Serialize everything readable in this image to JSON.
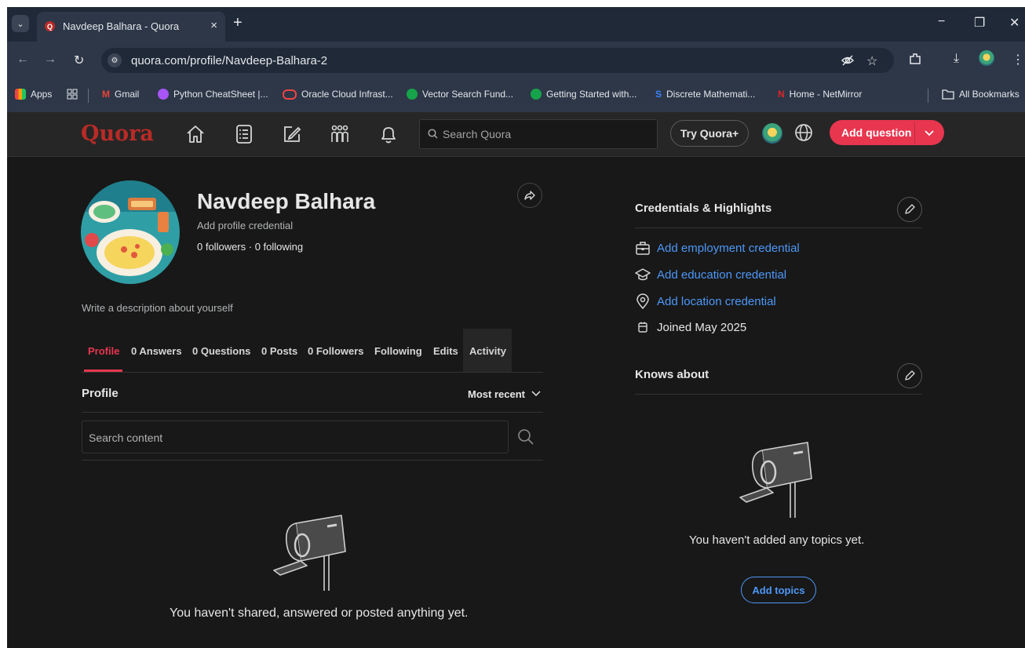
{
  "browser": {
    "tab_title": "Navdeep Balhara - Quora",
    "tab_close": "×",
    "new_tab": "+",
    "url": "quora.com/profile/Navdeep-Balhara-2",
    "bookmarks": [
      {
        "label": "Apps",
        "icon": "apps-grid-icon",
        "color": "#f59e0b"
      },
      {
        "label": "Gmail",
        "icon": "gmail-icon",
        "color": "#ea4335"
      },
      {
        "label": "Python CheatSheet |...",
        "icon": "python-icon",
        "color": "#a855f7"
      },
      {
        "label": "Oracle Cloud Infrast...",
        "icon": "oracle-icon",
        "color": "#ef4444"
      },
      {
        "label": "Vector Search Fund...",
        "icon": "mongodb-leaf-icon",
        "color": "#16a34a"
      },
      {
        "label": "Getting Started with...",
        "icon": "mongodb-leaf-icon",
        "color": "#16a34a"
      },
      {
        "label": "Discrete Mathemati...",
        "icon": "scribd-s-icon",
        "color": "#3b82f6"
      },
      {
        "label": "Home - NetMirror",
        "icon": "netmirror-icon",
        "color": "#dc2626"
      },
      {
        "label": "All Bookmarks",
        "icon": "folder-icon",
        "color": "#e5e7eb"
      }
    ]
  },
  "header": {
    "logo": "Quora",
    "search_placeholder": "Search Quora",
    "try_plus": "Try Quora+",
    "add_question": "Add question",
    "brand_color": "#b92b27",
    "accent_color": "#e8364f"
  },
  "profile": {
    "name": "Navdeep Balhara",
    "credential_prompt": "Add profile credential",
    "followers_line": "0 followers · 0 following",
    "description_prompt": "Write a description about yourself",
    "tabs": [
      "Profile",
      "0 Answers",
      "0 Questions",
      "0 Posts",
      "0 Followers",
      "Following",
      "Edits",
      "Activity"
    ],
    "active_tab": "Profile",
    "section_title": "Profile",
    "sort_label": "Most recent",
    "search_placeholder": "Search content",
    "empty_message": "You haven't shared, answered or posted anything yet."
  },
  "sidebar": {
    "credentials_title": "Credentials & Highlights",
    "employment": "Add employment credential",
    "education": "Add education credential",
    "location": "Add location credential",
    "joined": "Joined May 2025",
    "knows_title": "Knows about",
    "knows_empty": "You haven't added any topics yet.",
    "add_topics": "Add topics",
    "link_color": "#4d98f7"
  }
}
